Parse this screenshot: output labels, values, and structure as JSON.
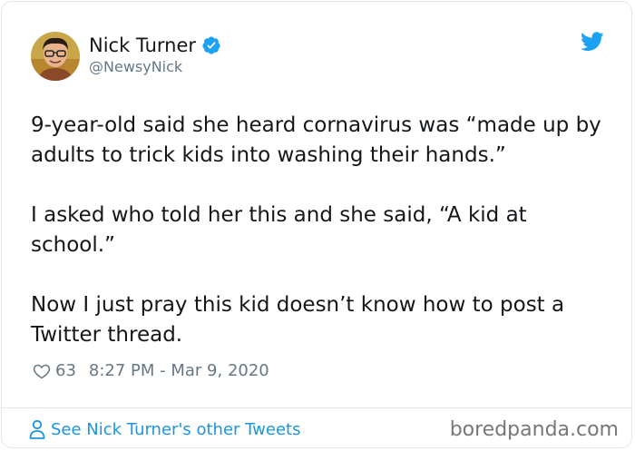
{
  "tweet": {
    "author": {
      "display_name": "Nick Turner",
      "handle": "@NewsyNick",
      "verified_icon": "verified-badge-icon"
    },
    "paragraphs": [
      "9-year-old said she heard cornavirus was “made up by adults to trick kids into washing their hands.”",
      "I asked who told her this and she said, “A kid at school.”",
      "Now I just pray this kid doesn’t know how to post a Twitter thread."
    ],
    "like_count": "63",
    "timestamp": "8:27 PM - Mar 9, 2020"
  },
  "footer": {
    "see_more_label": "See Nick Turner's other Tweets",
    "watermark": "boredpanda.com"
  },
  "colors": {
    "accent": "#1da1f2",
    "link": "#1b95e0",
    "text": "#14171a",
    "muted": "#657786",
    "border": "#e1e8ed"
  }
}
